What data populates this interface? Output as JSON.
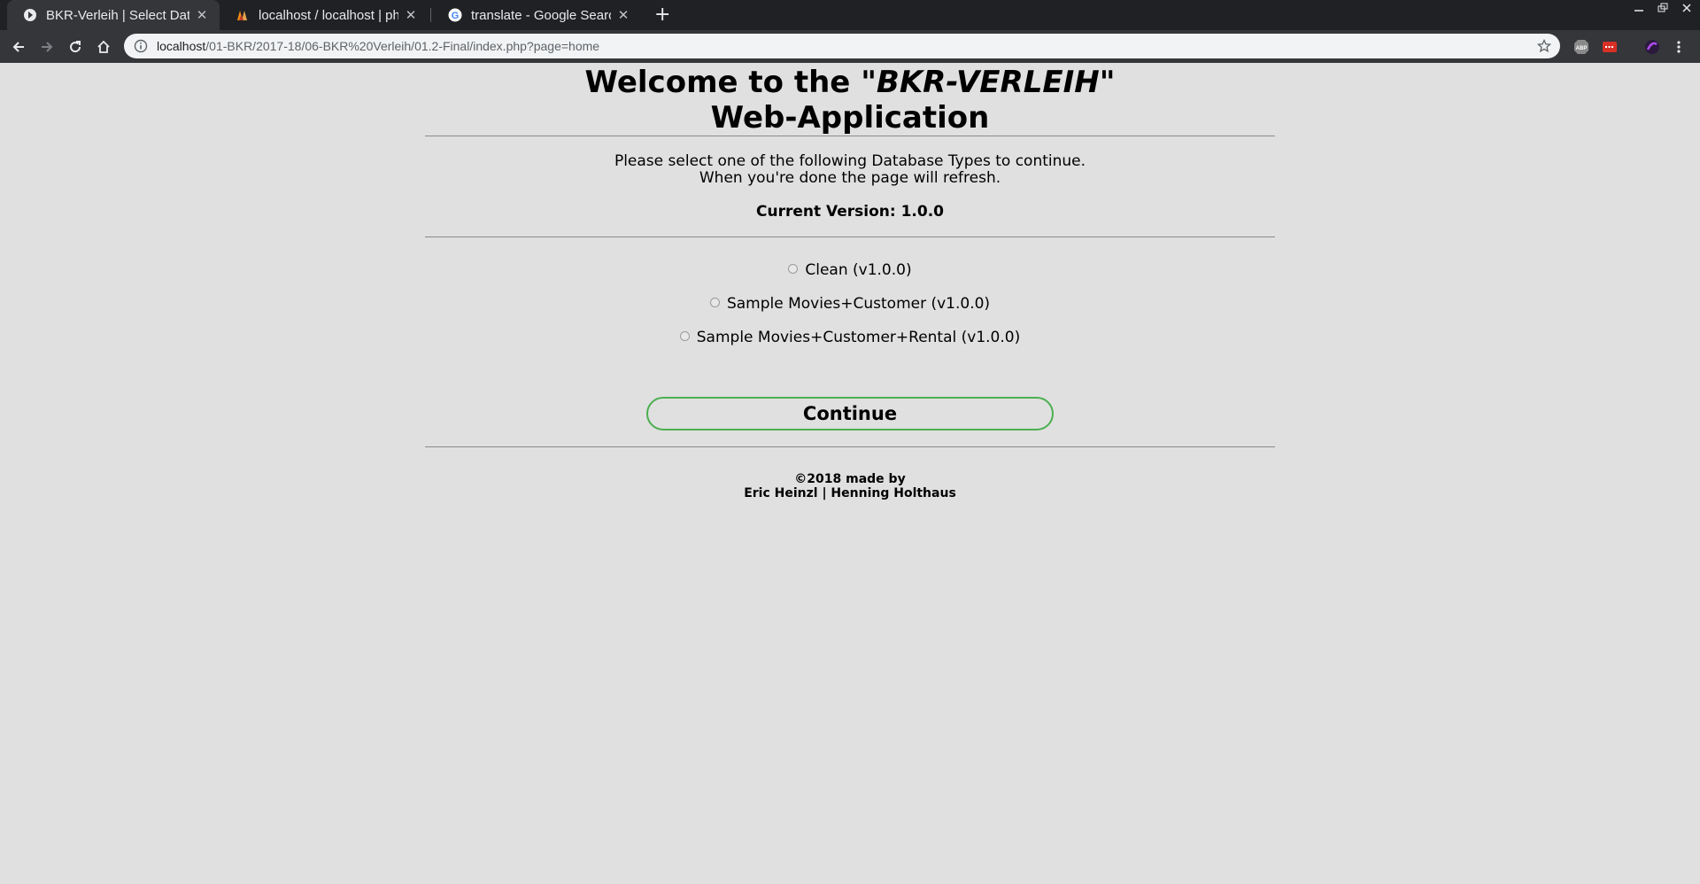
{
  "browser": {
    "tabs": [
      {
        "title": "BKR-Verleih | Select Datab",
        "active": true,
        "icon": "site-favicon"
      },
      {
        "title": "localhost / localhost | php",
        "active": false,
        "icon": "phpmyadmin-favicon"
      },
      {
        "title": "translate - Google Search",
        "active": false,
        "icon": "google-favicon"
      }
    ],
    "new_tab": "+",
    "address": {
      "host": "localhost",
      "path": "/01-BKR/2017-18/06-BKR%20Verleih/01.2-Final/index.php?page=home"
    },
    "extensions": [
      "abp-icon",
      "extension-red-icon",
      "extension-purple-icon"
    ]
  },
  "page": {
    "title_prefix": "Welcome to the ",
    "title_brand": "\"BKR-VERLEIH\"",
    "title_suffix": "Web-Application",
    "instruction_line1": "Please select one of the following Database Types to continue.",
    "instruction_line2": "When you're done the page will refresh.",
    "current_version": "Current Version: 1.0.0",
    "options": [
      {
        "label": "Clean (v1.0.0)",
        "selected": false
      },
      {
        "label": "Sample Movies+Customer (v1.0.0)",
        "selected": false
      },
      {
        "label": "Sample Movies+Customer+Rental (v1.0.0)",
        "selected": false
      }
    ],
    "continue_label": "Continue",
    "footer_line1": "©2018 made by",
    "footer_line2": "Eric Heinzl | Henning Holthaus"
  },
  "colors": {
    "page_background": "#e0e0e0",
    "button_border": "#4caf50",
    "chrome_dark": "#202124"
  }
}
